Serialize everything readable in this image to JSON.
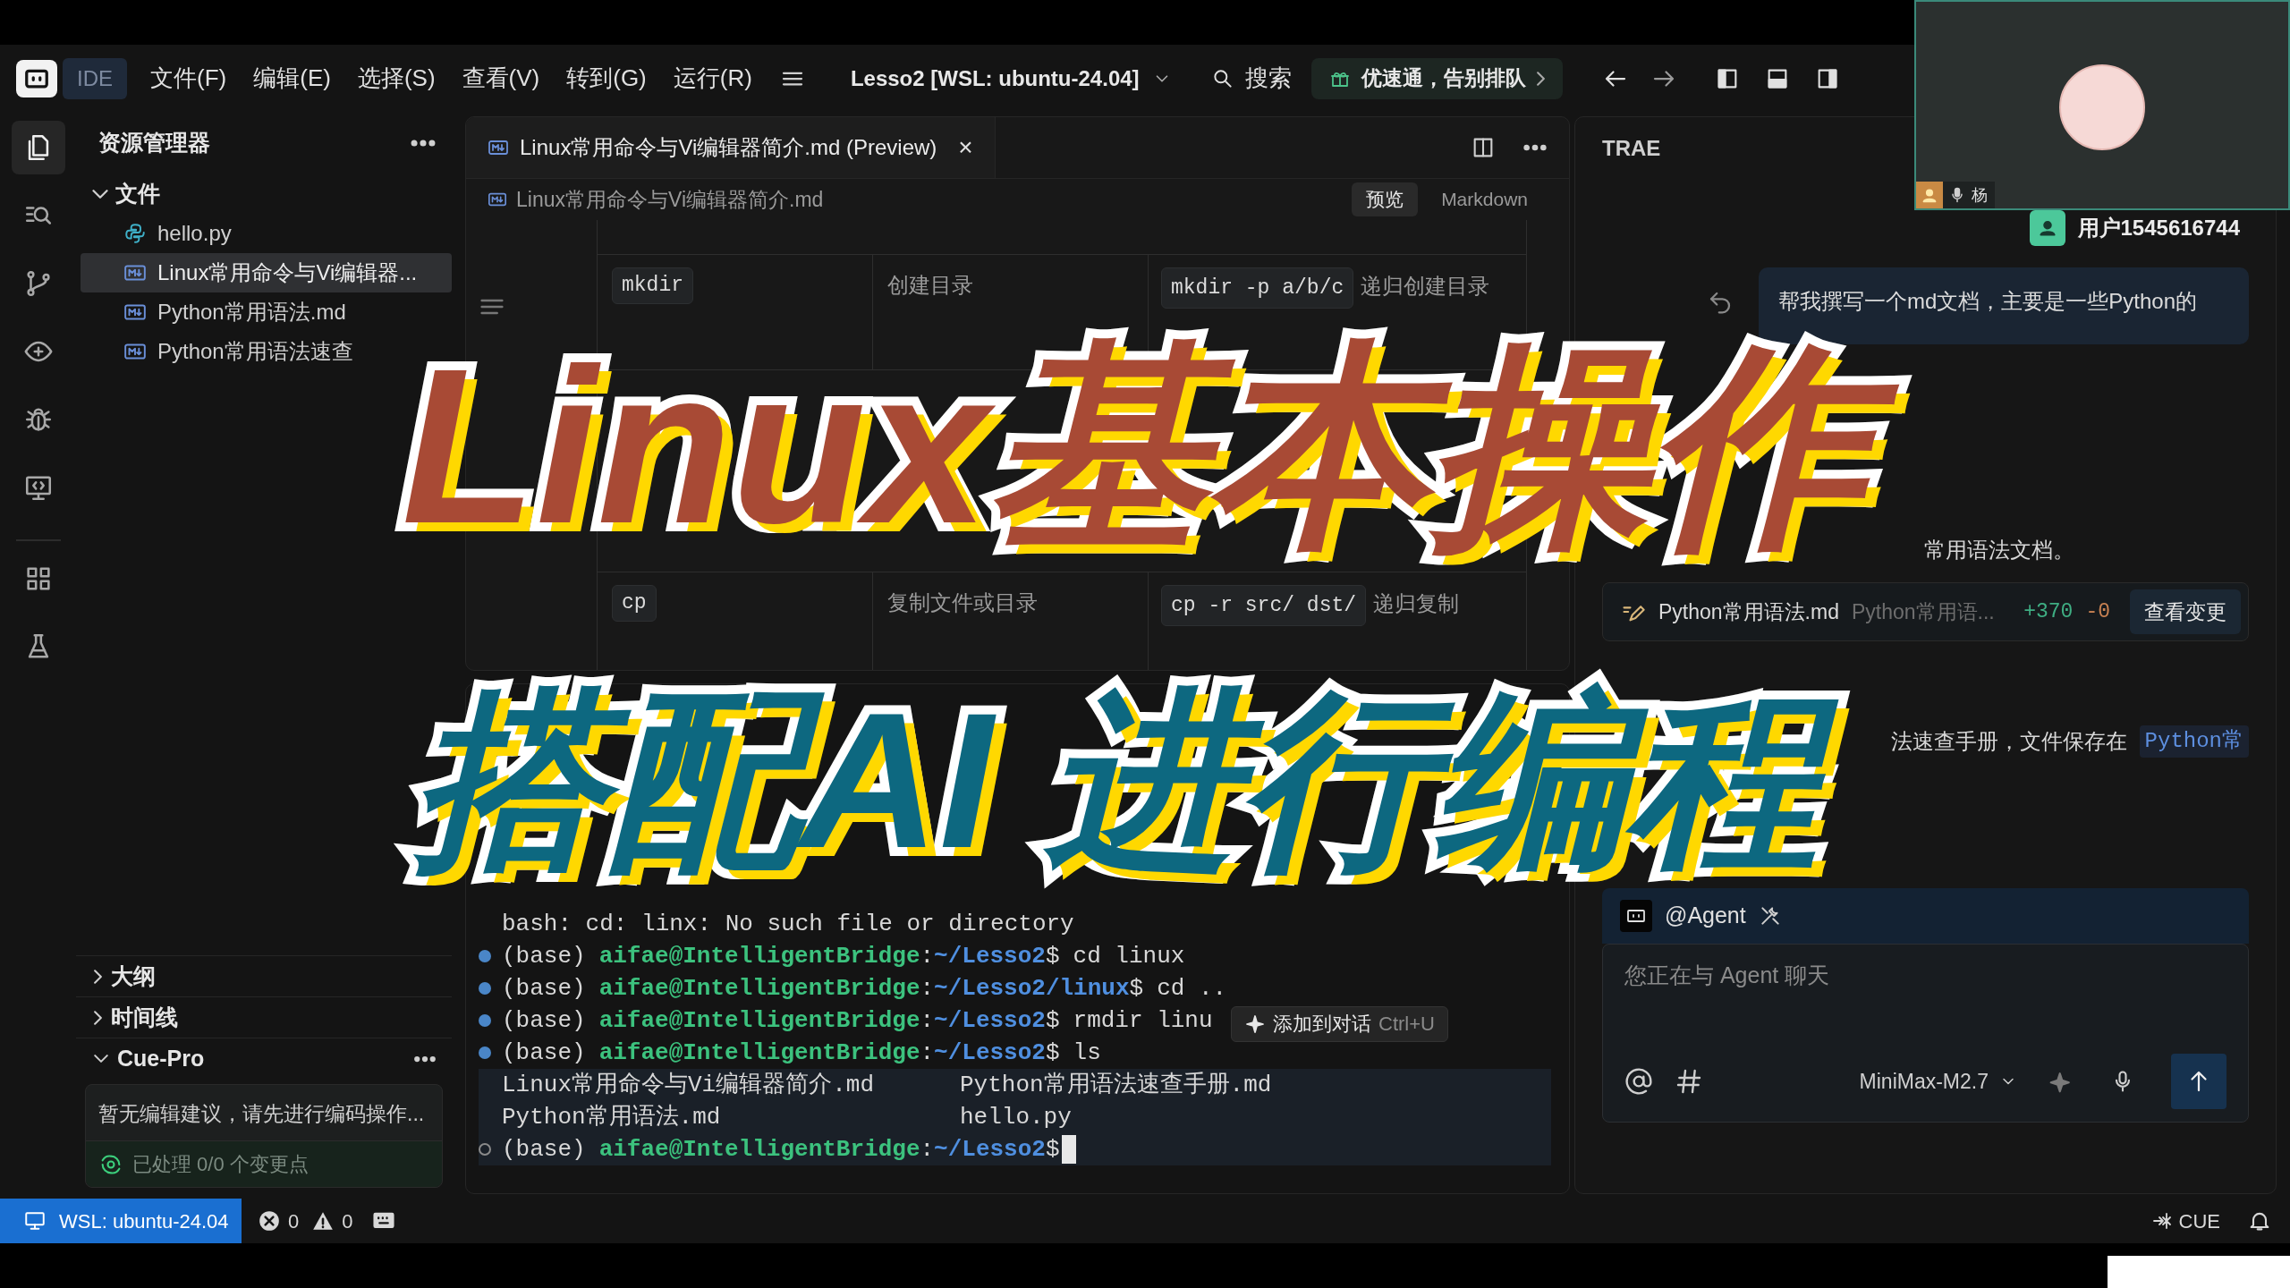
{
  "title_bar": {
    "app_tab": "IDE",
    "menus": [
      "文件(F)",
      "编辑(E)",
      "选择(S)",
      "查看(V)",
      "转到(G)",
      "运行(R)"
    ],
    "workspace": "Lesso2 [WSL: ubuntu-24.04]",
    "search": "搜索",
    "promo": "优速通，告别排队"
  },
  "camera": {
    "name": "杨"
  },
  "activity_bar": [
    {
      "kind": "files",
      "selected": true
    },
    {
      "kind": "search",
      "selected": false
    },
    {
      "kind": "git",
      "selected": false
    },
    {
      "kind": "eye",
      "selected": false
    },
    {
      "kind": "bug",
      "selected": false
    },
    {
      "kind": "remote",
      "selected": false
    },
    {
      "kind": "grid",
      "selected": false
    },
    {
      "kind": "flask",
      "selected": false
    }
  ],
  "explorer": {
    "title": "资源管理器",
    "section": {
      "label": "文件",
      "expanded": true
    },
    "files": [
      {
        "name": "hello.py",
        "kind": "python",
        "selected": false
      },
      {
        "name": "Linux常用命令与Vi编辑器...",
        "kind": "markdown",
        "selected": true
      },
      {
        "name": "Python常用语法.md",
        "kind": "markdown",
        "selected": false
      },
      {
        "name": "Python常用语法速查",
        "kind": "markdown",
        "selected": false
      }
    ],
    "panels": [
      {
        "label": "大纲",
        "expanded": false
      },
      {
        "label": "时间线",
        "expanded": false
      },
      {
        "label": "Cue-Pro",
        "expanded": true
      }
    ],
    "cue_pro": {
      "message": "暂无编辑建议，请先进行编码操作...",
      "status": "已处理 0/0 个变更点"
    }
  },
  "editor": {
    "tab": {
      "label": "Linux常用命令与Vi编辑器简介.md (Preview)",
      "close": "×"
    },
    "breadcrumb": "Linux常用命令与Vi编辑器简介.md",
    "view_modes": [
      {
        "label": "预览",
        "selected": true
      },
      {
        "label": "Markdown",
        "selected": false
      }
    ],
    "table_rows": [
      {
        "command": "mkdir",
        "description": "创建目录",
        "example": "mkdir -p a/b/c",
        "note": "递归创建目录"
      },
      {
        "command": "cp",
        "description": "复制文件或目录",
        "example": "cp -r src/ dst/",
        "note": "递归复制"
      }
    ]
  },
  "terminal": {
    "lines": [
      {
        "kind": "output",
        "text": "bash: cd: linx: No such file or directory"
      },
      {
        "kind": "prompt",
        "done": true,
        "env": "(base)",
        "user": "aifae@IntelligentBridge",
        "separator": ":",
        "path": "~/Lesso2",
        "end": "$",
        "command": "cd linux"
      },
      {
        "kind": "prompt",
        "done": true,
        "env": "(base)",
        "user": "aifae@IntelligentBridge",
        "separator": ":",
        "path": "~/Lesso2/linux",
        "end": "$",
        "command": "cd .."
      },
      {
        "kind": "prompt",
        "done": true,
        "env": "(base)",
        "user": "aifae@IntelligentBridge",
        "separator": ":",
        "path": "~/Lesso2",
        "end": "$",
        "command": "rmdir linu"
      },
      {
        "kind": "prompt",
        "done": true,
        "env": "(base)",
        "user": "aifae@IntelligentBridge",
        "separator": ":",
        "path": "~/Lesso2",
        "end": "$",
        "command": "ls"
      },
      {
        "kind": "columns",
        "items": [
          "Linux常用命令与Vi编辑器简介.md",
          "Python常用语法速查手册.md"
        ]
      },
      {
        "kind": "columns",
        "items": [
          "Python常用语法.md",
          "hello.py"
        ]
      },
      {
        "kind": "prompt",
        "done": false,
        "env": "(base)",
        "user": "aifae@IntelligentBridge",
        "separator": ":",
        "path": "~/Lesso2",
        "end": "$"
      }
    ],
    "tooltip": {
      "label": "添加到对话",
      "shortcut": "Ctrl+U"
    }
  },
  "chat": {
    "title": "TRAE",
    "user": "用户1545616744",
    "message": "帮我撰写一个md文档，主要是一些Python的",
    "reply_1": "常用语法文档。",
    "change_card": {
      "file": "Python常用语法.md",
      "path": "Python常用语...",
      "added": "+370",
      "removed": "-0",
      "button": "查看变更"
    },
    "reply_2": "法速查手册，文件保存在",
    "reply_2_code": "Python常",
    "agent": "@Agent",
    "input": {
      "placeholder": "您正在与 Agent 聊天",
      "model": "MiniMax-M2.7"
    }
  },
  "status_bar": {
    "remote": "WSL: ubuntu-24.04",
    "errors": "0",
    "warnings": "0",
    "cue": "CUE"
  },
  "overlay_title": [
    {
      "text": "Linux基本操作",
      "color": "#a84a35"
    },
    {
      "text": "搭配AI 进行编程",
      "color": "#0d6880"
    }
  ]
}
